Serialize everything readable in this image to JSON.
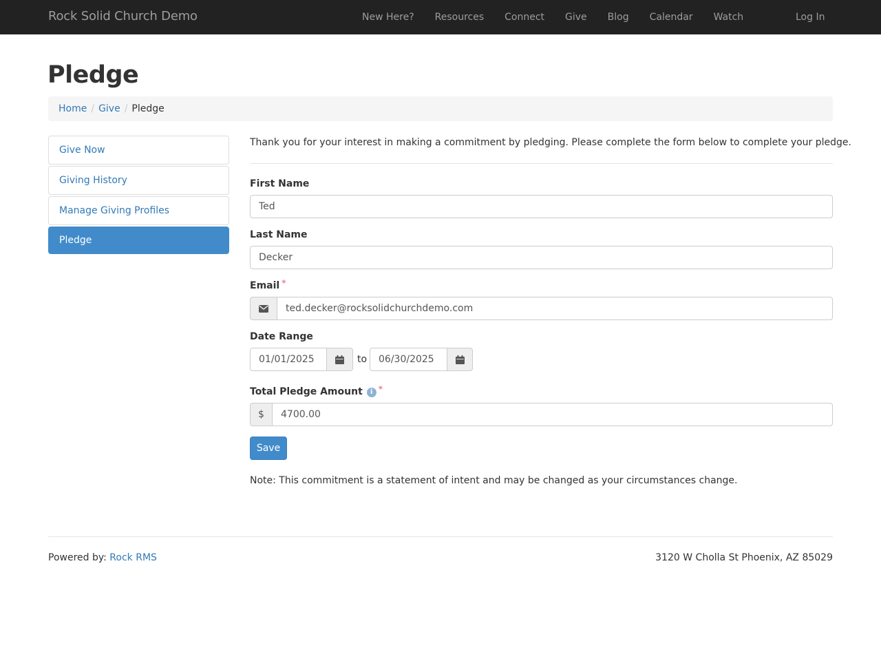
{
  "navbar": {
    "brand": "Rock Solid Church Demo",
    "items": [
      {
        "label": "New Here?"
      },
      {
        "label": "Resources"
      },
      {
        "label": "Connect"
      },
      {
        "label": "Give"
      },
      {
        "label": "Blog"
      },
      {
        "label": "Calendar"
      },
      {
        "label": "Watch"
      }
    ],
    "login": "Log In"
  },
  "page": {
    "title": "Pledge"
  },
  "breadcrumb": {
    "items": [
      {
        "label": "Home"
      },
      {
        "label": "Give"
      },
      {
        "label": "Pledge"
      }
    ],
    "separator": "/"
  },
  "sidebar": {
    "items": [
      {
        "label": "Give Now"
      },
      {
        "label": "Giving History"
      },
      {
        "label": "Manage Giving Profiles"
      },
      {
        "label": "Pledge"
      }
    ]
  },
  "form": {
    "intro": "Thank you for your interest in making a commitment by pledging. Please complete the form below to complete your pledge.",
    "first_name": {
      "label": "First Name",
      "value": "Ted"
    },
    "last_name": {
      "label": "Last Name",
      "value": "Decker"
    },
    "email": {
      "label": "Email",
      "value": "ted.decker@rocksolidchurchdemo.com",
      "required": "*"
    },
    "date_range": {
      "label": "Date Range",
      "start": "01/01/2025",
      "end": "06/30/2025",
      "to": "to"
    },
    "amount": {
      "label": "Total Pledge Amount",
      "currency": "$",
      "value": "4700.00",
      "required": "*",
      "info": "i"
    },
    "save_label": "Save",
    "note": "Note: This commitment is a statement of intent and may be changed as your circumstances change."
  },
  "footer": {
    "powered_by": "Powered by:",
    "powered_link": "Rock RMS",
    "address": "3120 W Cholla St Phoenix, AZ 85029"
  },
  "colors": {
    "navbar_bg": "#222222",
    "nav_text": "#9d9d9d",
    "link": "#337ab7",
    "primary": "#428bca",
    "required": "#e9848f"
  }
}
